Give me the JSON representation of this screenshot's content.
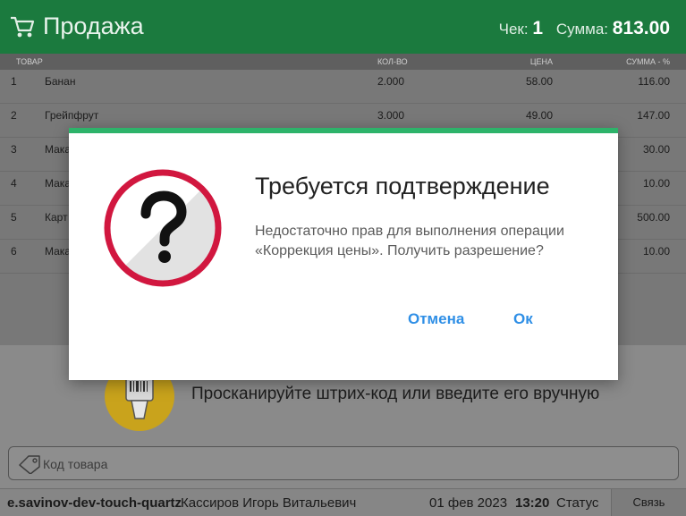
{
  "header": {
    "title": "Продажа",
    "check_label": "Чек:",
    "check_number": "1",
    "sum_label": "Сумма:",
    "sum_value": "813.00"
  },
  "table": {
    "columns": [
      "ТОВАР",
      "КОЛ-ВО",
      "ЦЕНА",
      "СУММА - %"
    ],
    "rows": [
      {
        "num": "1",
        "name": "Банан",
        "qty": "2.000",
        "price": "58.00",
        "sum": "116.00"
      },
      {
        "num": "2",
        "name": "Грейпфрут",
        "qty": "3.000",
        "price": "49.00",
        "sum": "147.00"
      },
      {
        "num": "3",
        "name": "Мака",
        "qty": "",
        "price": "",
        "sum": "30.00"
      },
      {
        "num": "4",
        "name": "Мака",
        "qty": "",
        "price": "",
        "sum": "10.00"
      },
      {
        "num": "5",
        "name": "Карт",
        "qty": "",
        "price": "",
        "sum": "500.00"
      },
      {
        "num": "6",
        "name": "Мака",
        "qty": "",
        "price": "",
        "sum": "10.00"
      }
    ]
  },
  "scan": {
    "prompt": "Просканируйте штрих-код или введите его вручную",
    "input_placeholder": "Код товара",
    "input_value": ""
  },
  "status_bar": {
    "host": "e.savinov-dev-touch-quartz",
    "user": "Кассиров Игорь Витальевич",
    "date": "01 фев 2023",
    "time": "13:20",
    "status": "Статус",
    "link": "Связь"
  },
  "dialog": {
    "title": "Требуется подтверждение",
    "message": "Недостаточно прав для выполнения операции «Коррекция цены». Получить разрешение?",
    "cancel_label": "Отмена",
    "ok_label": "Ок",
    "icon": "question-icon"
  },
  "colors": {
    "header_bg": "#1b7a3e",
    "dialog_accent": "#2db36a",
    "dialog_button": "#2f8fe6",
    "icon_ring": "#d1173f"
  },
  "icons": {
    "header": "cart-icon",
    "scanner": "barcode-scanner-icon",
    "input": "tag-icon"
  }
}
